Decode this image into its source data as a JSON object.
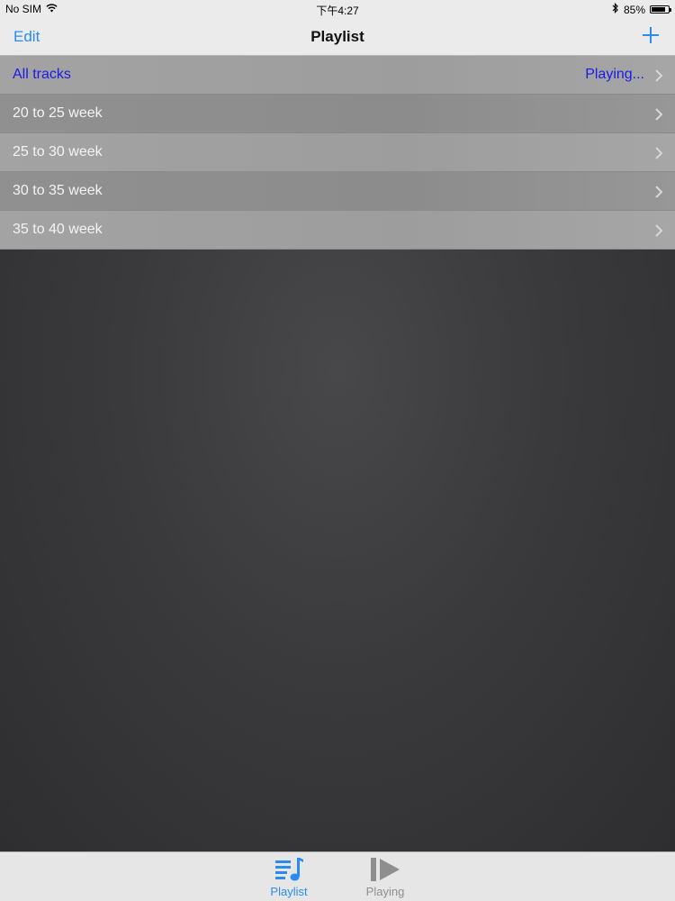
{
  "status_bar": {
    "carrier": "No SIM",
    "time": "下午4:27",
    "battery_percent": "85%",
    "battery_level": 0.85,
    "icons": [
      "wifi-icon",
      "bluetooth-icon",
      "battery-icon"
    ]
  },
  "nav": {
    "edit_label": "Edit",
    "title": "Playlist",
    "add_icon": "plus-icon"
  },
  "playlists": [
    {
      "label": "All tracks",
      "detail": "Playing...",
      "active": true
    },
    {
      "label": "20 to 25 week",
      "detail": "",
      "active": false
    },
    {
      "label": "25 to 30 week",
      "detail": "",
      "active": false
    },
    {
      "label": "30 to 35 week",
      "detail": "",
      "active": false
    },
    {
      "label": "35 to 40 week",
      "detail": "",
      "active": false
    }
  ],
  "tabs": [
    {
      "label": "Playlist",
      "icon": "playlist-icon",
      "selected": true
    },
    {
      "label": "Playing",
      "icon": "play-icon",
      "selected": false
    }
  ],
  "colors": {
    "accent": "#2a8cf0",
    "active_row_text": "#1a1ae6",
    "row_text": "#f4f4f4",
    "background": "#3a3a3c"
  }
}
